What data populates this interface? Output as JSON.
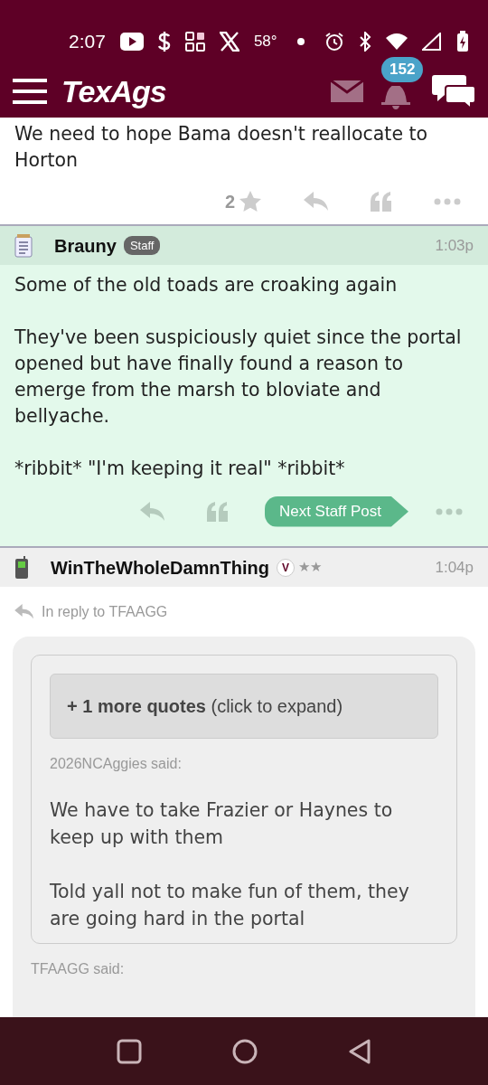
{
  "status_bar": {
    "time": "2:07",
    "temperature": "58°"
  },
  "header": {
    "logo": "TexAgs",
    "notification_count": "152"
  },
  "top_post": {
    "body": "We need to hope Bama doesn't reallocate to Horton",
    "star_count": "2"
  },
  "staff_post": {
    "author": "Brauny",
    "badge": "Staff",
    "time": "1:03p",
    "paragraphs": [
      "Some of the old toads are croaking again",
      "They've been suspiciously quiet since the portal opened but have finally found a reason to emerge from the marsh to bloviate and bellyache.",
      "*ribbit* \"I'm keeping it real\" *ribbit*"
    ],
    "next_button": "Next Staff Post"
  },
  "reply_post": {
    "author": "WinTheWholeDamnThing",
    "badge": "V",
    "rank": "★★",
    "time": "1:04p",
    "reply_to": "In reply to TFAAGG",
    "quote": {
      "expand_button": "**+ 1 more quotes** (click to expand)",
      "author": "2026NCAggies said:",
      "paragraphs": [
        "We have to take Frazier or Haynes to keep up with them",
        "Told yall not to make fun of them, they are going hard in the portal"
      ]
    },
    "next_quote_author": "TFAAGG said:"
  }
}
